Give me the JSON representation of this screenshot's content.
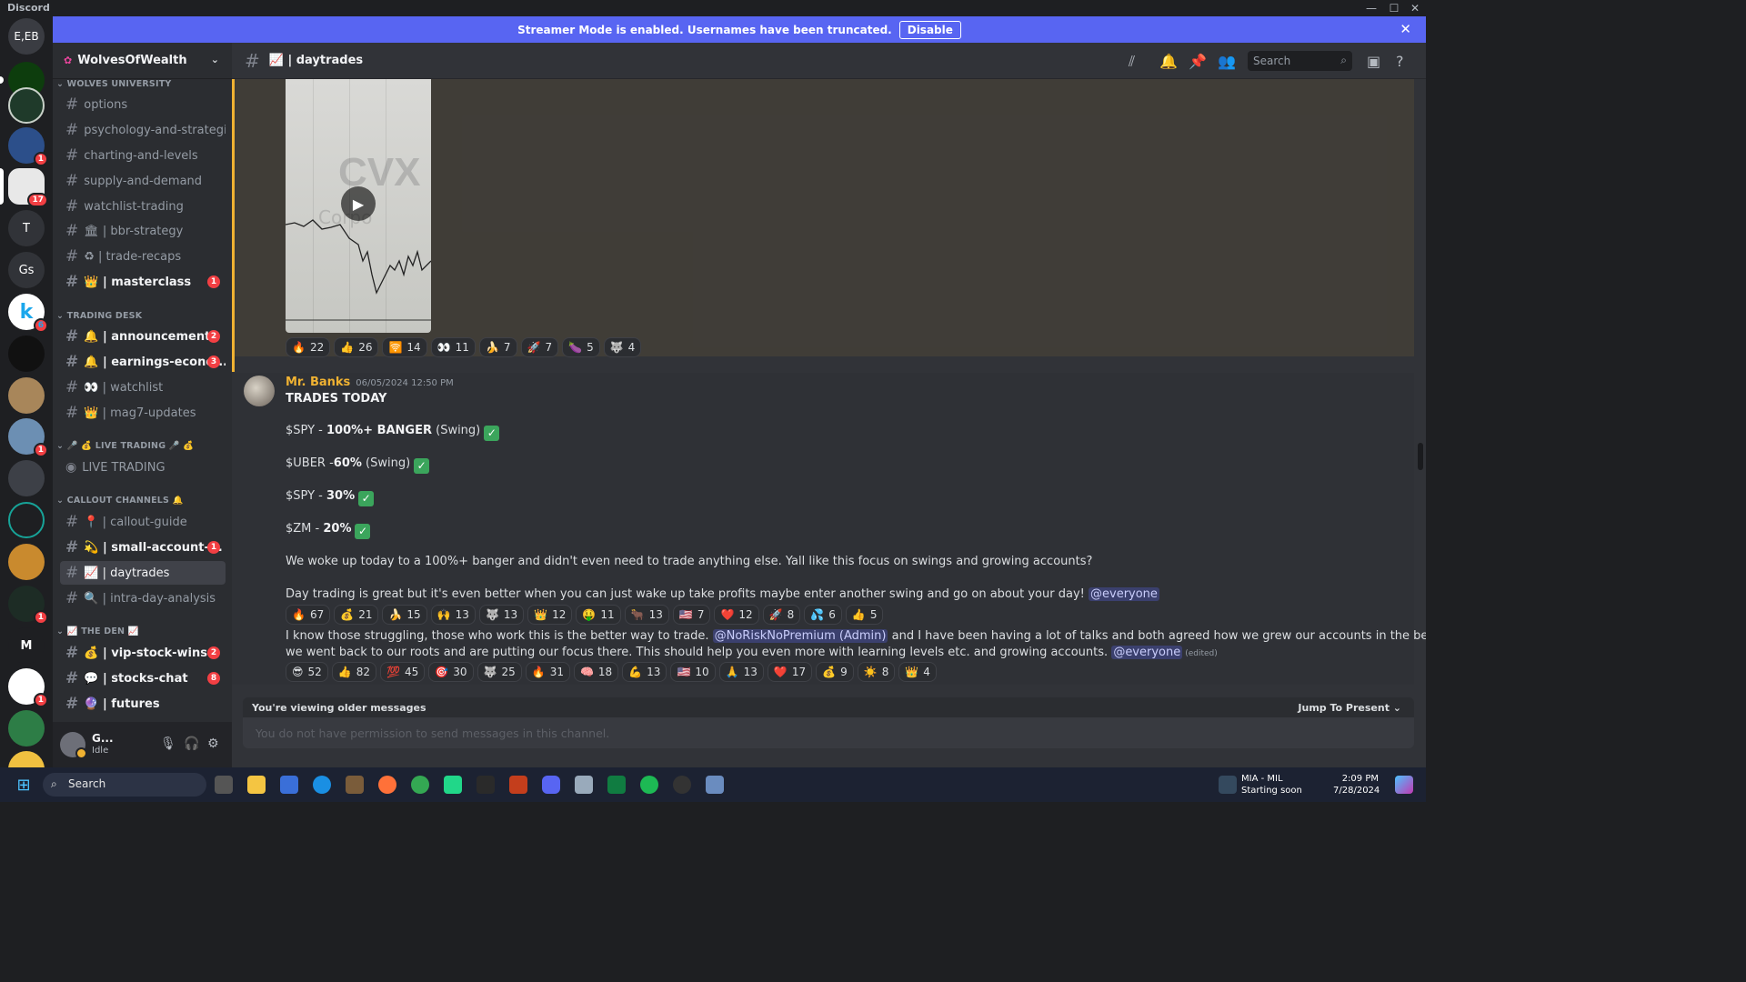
{
  "window": {
    "app_name": "Discord",
    "minimize": "—",
    "maximize": "☐",
    "close": "✕"
  },
  "banner": {
    "text": "Streamer Mode is enabled. Usernames have been truncated.",
    "button": "Disable",
    "close": "✕"
  },
  "servers": [
    {
      "label": "E,EB"
    },
    {
      "label": ""
    },
    {
      "label": ""
    },
    {
      "label": "",
      "badge": "1"
    },
    {
      "label": "",
      "badge": "17"
    },
    {
      "label": "T"
    },
    {
      "label": "Gs"
    },
    {
      "label": "k",
      "badge": "6"
    },
    {
      "label": ""
    },
    {
      "label": ""
    },
    {
      "label": "",
      "badge": "1"
    },
    {
      "label": ""
    },
    {
      "label": ""
    },
    {
      "label": ""
    },
    {
      "label": "",
      "badge": "1"
    },
    {
      "label": "M"
    },
    {
      "label": "",
      "badge": "1"
    },
    {
      "label": ""
    },
    {
      "label": ""
    }
  ],
  "guild": {
    "name": "WolvesOfWealth",
    "chevron": "⌄"
  },
  "categories": {
    "wolves_university": "WOLVES UNIVERSITY",
    "trading_desk": "TRADING DESK",
    "live_trading": "🎤 💰 LIVE TRADING 🎤 💰",
    "callout_channels": "CALLOUT CHANNELS 🔔",
    "the_den": "📈 THE DEN 📈"
  },
  "channels": {
    "options": "options",
    "psychology": "psychology-and-strategi...",
    "charting": "charting-and-levels",
    "supply": "supply-and-demand",
    "watchlist_trading": "watchlist-trading",
    "bbr": "🏛 | bbr-strategy",
    "recaps": "♻ | trade-recaps",
    "masterclass": "👑 | masterclass",
    "masterclass_badge": "1",
    "announcements": "🔔 | announcements",
    "announcements_badge": "2",
    "earnings": "🔔 | earnings-econo...",
    "earnings_badge": "3",
    "watchlist": "👀 | watchlist",
    "mag7": "👑 | mag7-updates",
    "live": "LIVE TRADING",
    "callout_guide": "📍 | callout-guide",
    "small_account": "💫 | small-account-...",
    "small_account_badge": "1",
    "daytrades": "📈 | daytrades",
    "intraday": "🔍 | intra-day-analysis",
    "vip": "💰 | vip-stock-wins",
    "vip_badge": "2",
    "stocks_chat": "💬 | stocks-chat",
    "stocks_chat_badge": "8",
    "futures": "🔮 | futures"
  },
  "user": {
    "name": "G...",
    "status": "Idle"
  },
  "channel_header": {
    "name": "📈 | daytrades",
    "search_placeholder": "Search"
  },
  "video": {
    "watermark": "CVX",
    "watermark2": "Corpo",
    "play": "▶"
  },
  "reactions_1": [
    {
      "e": "🔥",
      "n": "22"
    },
    {
      "e": "👍",
      "n": "26"
    },
    {
      "e": "🛜",
      "n": "14"
    },
    {
      "e": "👀",
      "n": "11"
    },
    {
      "e": "🍌",
      "n": "7"
    },
    {
      "e": "🚀",
      "n": "7"
    },
    {
      "e": "🍆",
      "n": "5"
    },
    {
      "e": "🐺",
      "n": "4"
    }
  ],
  "message": {
    "author": "Mr. Banks",
    "timestamp": "06/05/2024 12:50 PM",
    "title": "TRADES TODAY",
    "trades": [
      {
        "pre": "$SPY - ",
        "bold": "100%+ BANGER",
        "post": " (Swing)"
      },
      {
        "pre": "$UBER -",
        "bold": "60%",
        "post": " (Swing)"
      },
      {
        "pre": "$SPY - ",
        "bold": "30%",
        "post": ""
      },
      {
        "pre": "$ZM - ",
        "bold": "20%",
        "post": ""
      }
    ],
    "check": "✓",
    "para1": "We woke up today to a 100%+ banger and didn't even need to trade anything else. Yall like this focus on swings and growing accounts?",
    "para2": "Day trading is great but it's even better when you can just wake up take profits maybe enter another swing and go on about your day!",
    "everyone": "@everyone"
  },
  "reactions_2": [
    {
      "e": "🔥",
      "n": "67"
    },
    {
      "e": "💰",
      "n": "21"
    },
    {
      "e": "🍌",
      "n": "15"
    },
    {
      "e": "🙌",
      "n": "13"
    },
    {
      "e": "🐺",
      "n": "13"
    },
    {
      "e": "👑",
      "n": "12"
    },
    {
      "e": "🤑",
      "n": "11"
    },
    {
      "e": "🐂",
      "n": "13"
    },
    {
      "e": "🇺🇸",
      "n": "7"
    },
    {
      "e": "❤️",
      "n": "12"
    },
    {
      "e": "🚀",
      "n": "8"
    },
    {
      "e": "💦",
      "n": "6"
    },
    {
      "e": "👍",
      "n": "5"
    }
  ],
  "message2": {
    "a": "I know those struggling, those who work this is the better way to trade.",
    "mention": "@NoRiskNoPremium (Admin)",
    "b": "and I have been having a lot of talks and both agreed how we grew our accounts in the beginning was swinging. So",
    "c": "we went back to our roots and are putting our focus there. This should help you even more with learning levels etc. and growing accounts.",
    "everyone": "@everyone",
    "edited": "(edited)"
  },
  "reactions_3": [
    {
      "e": "😎",
      "n": "52"
    },
    {
      "e": "👍",
      "n": "82"
    },
    {
      "e": "💯",
      "n": "45"
    },
    {
      "e": "🎯",
      "n": "30"
    },
    {
      "e": "🐺",
      "n": "25"
    },
    {
      "e": "🔥",
      "n": "31"
    },
    {
      "e": "🧠",
      "n": "18"
    },
    {
      "e": "💪",
      "n": "13"
    },
    {
      "e": "🇺🇸",
      "n": "10"
    },
    {
      "e": "🙏",
      "n": "13"
    },
    {
      "e": "❤️",
      "n": "17"
    },
    {
      "e": "💰",
      "n": "9"
    },
    {
      "e": "☀️",
      "n": "8"
    },
    {
      "e": "👑",
      "n": "4"
    }
  ],
  "older": {
    "text": "You're viewing older messages",
    "jump": "Jump To Present ⌄"
  },
  "composer": {
    "placeholder": "You do not have permission to send messages in this channel."
  },
  "taskbar": {
    "search": "Search",
    "weather_title": "MIA - MIL",
    "weather_sub": "Starting soon",
    "time": "2:09 PM",
    "date": "7/28/2024"
  }
}
